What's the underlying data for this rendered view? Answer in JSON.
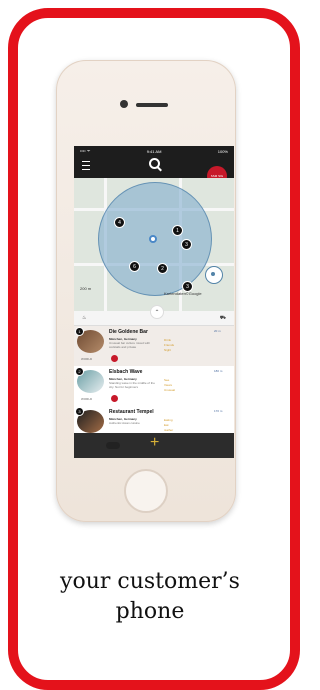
{
  "caption": {
    "line1": "your customer’s",
    "line2": "phone"
  },
  "phone": {
    "status": {
      "carrier": "•••• ᯤ",
      "time": "9:41 AM",
      "battery": "100%"
    },
    "badge_text": "SSM\nSIG",
    "map": {
      "labels": {
        "left": "200 m",
        "right": "Kartendaten©Google"
      }
    },
    "toolbar": {
      "left": "♨",
      "right": "⛟"
    },
    "list": [
      {
        "num": "1",
        "name": "Die Goldene Bar",
        "city": "München, Germany",
        "desc": "Unusual bar culture mixed with cocktails and private",
        "meta": [
          "Drink",
          "Friends",
          "Night"
        ],
        "dist": "20 m",
        "type": "WORLD"
      },
      {
        "num": "2",
        "name": "Elsbach Wave",
        "city": "München, Germany",
        "desc": "Standing wave in the middle of the city. Not for beginners",
        "meta": [
          "See",
          "Views",
          "Unusual"
        ],
        "dist": "180 m",
        "type": "WORLD"
      },
      {
        "num": "3",
        "name": "Restaurant Tempel",
        "city": "München, Germany",
        "desc": "Authentic Asian cuisine",
        "meta": [
          "Eating",
          "Eat",
          "Gather"
        ],
        "dist": "170 m",
        "type": "WORLD"
      }
    ],
    "cc": "CC"
  }
}
